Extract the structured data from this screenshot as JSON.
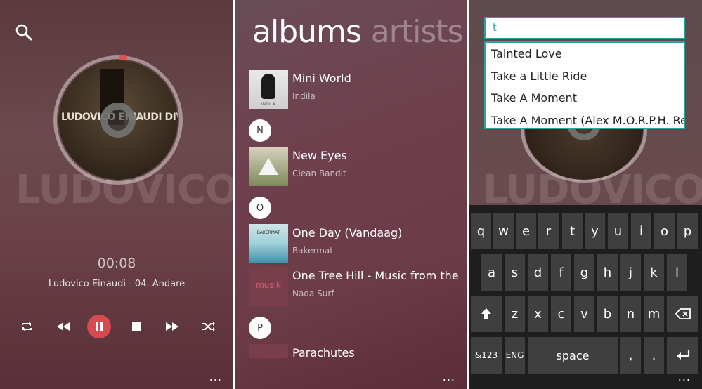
{
  "player": {
    "album_cover_text": "LUDOVICO EINAUDI DIVENIRE",
    "background_text": "LUDOVICO EINA",
    "time": "00:08",
    "track": "Ludovico Einaudi -  04. Andare",
    "more": "..."
  },
  "albums_screen": {
    "pivot_active": "albums",
    "pivot_inactive": "artists",
    "items": [
      {
        "title": "Mini World",
        "artist": "Indila",
        "art_label": "INDILA"
      },
      {
        "title": "New Eyes",
        "artist": "Clean Bandit",
        "art_label": ""
      },
      {
        "title": "One Day (Vandaag)",
        "artist": "Bakermat",
        "art_label": "BAKERMAT"
      },
      {
        "title": "One Tree Hill - Music from the Te",
        "artist": "Nada Surf",
        "art_label": "musik"
      },
      {
        "title": "Parachutes",
        "artist": "",
        "art_label": ""
      }
    ],
    "letters": [
      "N",
      "O",
      "P"
    ],
    "more": "..."
  },
  "search_screen": {
    "query": "t",
    "suggestions": [
      "Tainted Love",
      "Take a Little Ride",
      "Take A Moment",
      "Take A Moment (Alex M.O.R.P.H. Rei"
    ],
    "background_text": "LUDOVICO EINA",
    "keyboard": {
      "row1": [
        "q",
        "w",
        "e",
        "r",
        "t",
        "y",
        "u",
        "i",
        "o",
        "p"
      ],
      "row2": [
        "a",
        "s",
        "d",
        "f",
        "g",
        "h",
        "j",
        "k",
        "l"
      ],
      "row3": [
        "z",
        "x",
        "c",
        "v",
        "b",
        "n",
        "m"
      ],
      "sym_label": "&123",
      "lang_label": "ENG",
      "space_label": "space",
      "comma": ",",
      "period": "."
    },
    "more": "..."
  },
  "colors": {
    "accent_red": "#d64a52",
    "accent_teal": "#2aa3a0"
  }
}
